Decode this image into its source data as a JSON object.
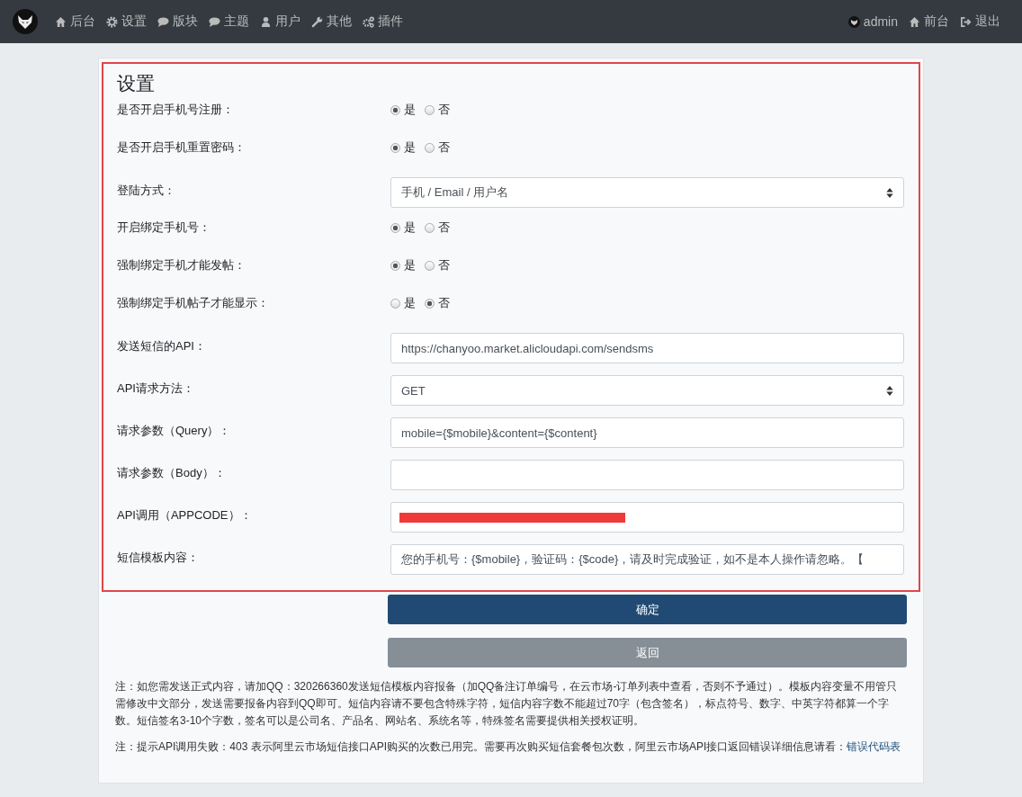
{
  "navbar": {
    "left": [
      {
        "kind": "home",
        "label": "后台"
      },
      {
        "kind": "gear",
        "label": "设置"
      },
      {
        "kind": "bubble",
        "label": "版块"
      },
      {
        "kind": "bubble",
        "label": "主题"
      },
      {
        "kind": "user",
        "label": "用户"
      },
      {
        "kind": "wrench",
        "label": "其他"
      },
      {
        "kind": "gears",
        "label": "插件"
      }
    ],
    "right": [
      {
        "kind": "avatar",
        "label": "admin"
      },
      {
        "kind": "home",
        "label": "前台"
      },
      {
        "kind": "signout",
        "label": "退出"
      }
    ]
  },
  "card": {
    "title": "设置",
    "fields": [
      {
        "kind": "radio",
        "label": "是否开启手机号注册：",
        "options": [
          {
            "label": "是",
            "selected": true
          },
          {
            "label": "否",
            "selected": false
          }
        ]
      },
      {
        "kind": "radio",
        "label": "是否开启手机重置密码：",
        "options": [
          {
            "label": "是",
            "selected": true
          },
          {
            "label": "否",
            "selected": false
          }
        ]
      },
      {
        "kind": "select",
        "label": "登陆方式：",
        "value": "手机 / Email / 用户名"
      },
      {
        "kind": "radio",
        "label": "开启绑定手机号：",
        "options": [
          {
            "label": "是",
            "selected": true
          },
          {
            "label": "否",
            "selected": false
          }
        ]
      },
      {
        "kind": "radio",
        "label": "强制绑定手机才能发帖：",
        "options": [
          {
            "label": "是",
            "selected": true
          },
          {
            "label": "否",
            "selected": false
          }
        ]
      },
      {
        "kind": "radio",
        "label": "强制绑定手机帖子才能显示：",
        "options": [
          {
            "label": "是",
            "selected": false
          },
          {
            "label": "否",
            "selected": true
          }
        ]
      },
      {
        "kind": "text",
        "label": "发送短信的API：",
        "value": "https://chanyoo.market.alicloudapi.com/sendsms"
      },
      {
        "kind": "select",
        "label": "API请求方法：",
        "value": "GET"
      },
      {
        "kind": "text",
        "label": "请求参数（Query）：",
        "value": "mobile={$mobile}&content={$content}"
      },
      {
        "kind": "text",
        "label": "请求参数（Body）："
      },
      {
        "kind": "redacted",
        "label": "API调用（APPCODE）："
      },
      {
        "kind": "text",
        "label": "短信模板内容：",
        "value": "您的手机号：{$mobile}，验证码：{$code}，请及时完成验证，如不是本人操作请忽略。【"
      }
    ],
    "buttons": [
      {
        "kind": "primary",
        "label": "确定"
      },
      {
        "kind": "secondary",
        "label": "返回"
      }
    ],
    "notes": [
      {
        "text": "注：如您需发送正式内容，请加QQ：320266360发送短信模板内容报备（加QQ备注订单编号，在云市场-订单列表中查看，否则不予通过）。模板内容变量不用管只需修改中文部分，发送需要报备内容到QQ即可。短信内容请不要包含特殊字符，短信内容字数不能超过70字（包含签名），标点符号、数字、中英字符都算一个字数。短信签名3-10个字数，签名可以是公司名、产品名、网站名、系统名等，特殊签名需要提供相关授权证明。"
      },
      {
        "text": "注：提示API调用失败：403 表示阿里云市场短信接口API购买的次数已用完。需要再次购买短信套餐包次数，阿里云市场API接口返回错误详细信息请看：",
        "link": "错误代码表"
      }
    ]
  }
}
